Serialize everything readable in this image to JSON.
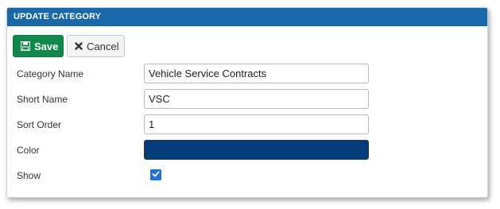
{
  "panel": {
    "title": "UPDATE CATEGORY"
  },
  "toolbar": {
    "save_label": "Save",
    "save_icon": "floppy-disk-icon",
    "cancel_label": "Cancel",
    "cancel_icon": "x-icon"
  },
  "form": {
    "category_name": {
      "label": "Category Name",
      "value": "Vehicle Service Contracts"
    },
    "short_name": {
      "label": "Short Name",
      "value": "VSC"
    },
    "sort_order": {
      "label": "Sort Order",
      "value": "1"
    },
    "color": {
      "label": "Color",
      "value": "#003d7a"
    },
    "show": {
      "label": "Show",
      "checked": true
    }
  },
  "colors": {
    "header_bg": "#1769aa",
    "save_bg": "#108a4a",
    "checkbox": "#1a73e8"
  }
}
